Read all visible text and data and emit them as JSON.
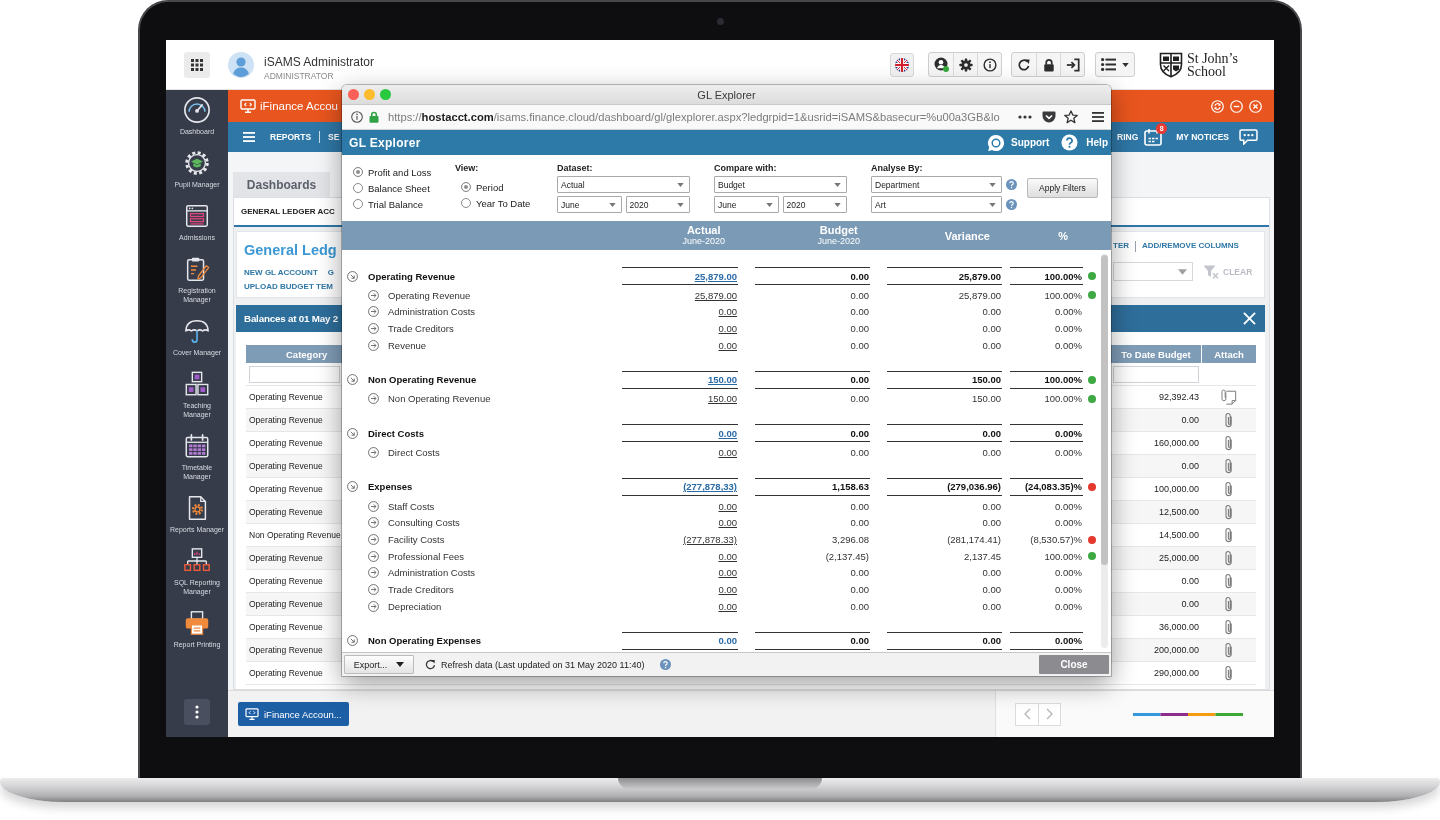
{
  "top_bar": {
    "user_name": "iSAMS Administrator",
    "user_role": "ADMINISTRATOR",
    "school_name": "St John’s School"
  },
  "sidebar": {
    "items": [
      {
        "label": "Dashboard"
      },
      {
        "label": "Pupil Manager"
      },
      {
        "label": "Admissions"
      },
      {
        "label": "Registration Manager"
      },
      {
        "label": "Cover Manager"
      },
      {
        "label": "Teaching Manager"
      },
      {
        "label": "Timetable Manager"
      },
      {
        "label": "Reports Manager"
      },
      {
        "label": "SQL Reporting Manager"
      },
      {
        "label": "Report Printing"
      }
    ]
  },
  "app_bar": {
    "title": "iFinance Accou"
  },
  "nav_bar": {
    "left_links": [
      "REPORTS",
      "SE"
    ],
    "cut_link": "RING",
    "calendar_badge": "8",
    "notices_link": "MY NOTICES"
  },
  "page": {
    "tabs": [
      {
        "label": "Dashboards",
        "selected": false
      }
    ],
    "sub_tab": "GENERAL LEDGER ACC",
    "title": "General Ledg",
    "action_links": [
      [
        "NEW GL ACCOUNT",
        "G"
      ],
      [
        "UPLOAD BUDGET TEM"
      ]
    ],
    "right_links": [
      "TER",
      "ADD/REMOVE COLUMNS"
    ],
    "clear_label": "CLEAR",
    "balances_title": "Balances at 01 May 2",
    "table": {
      "columns": [
        "Category",
        "To Date Budget",
        "Attach"
      ],
      "rows": [
        {
          "category": "Operating Revenue",
          "to_date_budget": "92,392.43",
          "kind": "document"
        },
        {
          "category": "Operating Revenue",
          "to_date_budget": "0.00",
          "kind": "clip"
        },
        {
          "category": "Operating Revenue",
          "to_date_budget": "160,000.00",
          "kind": "clip"
        },
        {
          "category": "Operating Revenue",
          "to_date_budget": "0.00",
          "kind": "clip"
        },
        {
          "category": "Operating Revenue",
          "to_date_budget": "100,000.00",
          "kind": "clip"
        },
        {
          "category": "Operating Revenue",
          "to_date_budget": "12,500.00",
          "kind": "clip"
        },
        {
          "category": "Non Operating Revenue",
          "to_date_budget": "14,500.00",
          "kind": "clip"
        },
        {
          "category": "Operating Revenue",
          "to_date_budget": "25,000.00",
          "kind": "clip"
        },
        {
          "category": "Operating Revenue",
          "to_date_budget": "0.00",
          "kind": "clip"
        },
        {
          "category": "Operating Revenue",
          "to_date_budget": "0.00",
          "kind": "clip"
        },
        {
          "category": "Operating Revenue",
          "to_date_budget": "36,000.00",
          "kind": "clip"
        },
        {
          "category": "Operating Revenue",
          "to_date_budget": "200,000.00",
          "kind": "clip"
        },
        {
          "category": "Operating Revenue",
          "to_date_budget": "290,000.00",
          "kind": "clip"
        }
      ]
    }
  },
  "taskbar": {
    "window_button": "iFinance Accoun..."
  },
  "gl_window": {
    "title": "GL Explorer",
    "url": "https://**hostacct.com**/isams.finance.cloud/dashboard/gl/glexplorer.aspx?ledgrpid=1&usrid=iSAMS&basecur=%u00a3GB&lo",
    "app_title": "GL Explorer",
    "support_label": "Support",
    "help_label": "Help",
    "report_types": [
      {
        "label": "Profit and Loss",
        "selected": true
      },
      {
        "label": "Balance Sheet",
        "selected": false
      },
      {
        "label": "Trial Balance",
        "selected": false
      }
    ],
    "view": {
      "label": "View:",
      "options": [
        {
          "label": "Period",
          "selected": true
        },
        {
          "label": "Year To Date",
          "selected": false
        }
      ]
    },
    "filters": [
      {
        "label": "Dataset:",
        "value": "Actual",
        "sub_values": [
          "June",
          "2020"
        ],
        "help": false
      },
      {
        "label": "Compare with:",
        "value": "Budget",
        "sub_values": [
          "June",
          "2020"
        ],
        "help": false
      },
      {
        "label": "Analyse By:",
        "value": "Department",
        "sub_values": [
          "Art"
        ],
        "help": true
      }
    ],
    "apply_button": "Apply Filters",
    "columns": [
      {
        "title": "Actual",
        "subtitle": "June-2020"
      },
      {
        "title": "Budget",
        "subtitle": "June-2020"
      },
      {
        "title": "Variance"
      },
      {
        "title": "%"
      }
    ],
    "groups": [
      {
        "name": "Operating Revenue",
        "actual": "25,879.00",
        "budget": "0.00",
        "variance": "25,879.00",
        "percent": "100.00%",
        "color": "#3ea843",
        "underlined": true,
        "children": [
          {
            "name": "Operating Revenue",
            "actual": "25,879.00",
            "budget": "0.00",
            "variance": "25,879.00",
            "percent": "100.00%",
            "color": "#3ea843"
          },
          {
            "name": "Administration Costs",
            "actual": "0.00",
            "budget": "0.00",
            "variance": "0.00",
            "percent": "0.00%"
          },
          {
            "name": "Trade Creditors",
            "actual": "0.00",
            "budget": "0.00",
            "variance": "0.00",
            "percent": "0.00%"
          },
          {
            "name": "Revenue",
            "actual": "0.00",
            "budget": "0.00",
            "variance": "0.00",
            "percent": "0.00%"
          }
        ]
      },
      {
        "name": "Non Operating Revenue",
        "actual": "150.00",
        "budget": "0.00",
        "variance": "150.00",
        "percent": "100.00%",
        "color": "#3ea843",
        "underlined": true,
        "children": [
          {
            "name": "Non Operating Revenue",
            "actual": "150.00",
            "budget": "0.00",
            "variance": "150.00",
            "percent": "100.00%",
            "color": "#3ea843"
          }
        ]
      },
      {
        "name": "Direct Costs",
        "actual": "0.00",
        "budget": "0.00",
        "variance": "0.00",
        "percent": "0.00%",
        "underlined": true,
        "children": [
          {
            "name": "Direct Costs",
            "actual": "0.00",
            "budget": "0.00",
            "variance": "0.00",
            "percent": "0.00%"
          }
        ]
      },
      {
        "name": "Expenses",
        "actual": "(277,878,33)",
        "budget": "1,158.63",
        "variance": "(279,036.96)",
        "percent": "(24,083.35)%",
        "color": "#e5392f",
        "underlined": true,
        "children": [
          {
            "name": "Staff Costs",
            "actual": "0.00",
            "budget": "0.00",
            "variance": "0.00",
            "percent": "0.00%"
          },
          {
            "name": "Consulting Costs",
            "actual": "0.00",
            "budget": "0.00",
            "variance": "0.00",
            "percent": "0.00%"
          },
          {
            "name": "Facility Costs",
            "actual": "(277,878.33)",
            "budget": "3,296.08",
            "variance": "(281,174.41)",
            "percent": "(8,530.57)%",
            "color": "#e5392f"
          },
          {
            "name": "Professional Fees",
            "actual": "0.00",
            "budget": "(2,137.45)",
            "variance": "2,137.45",
            "percent": "100.00%",
            "color": "#3ea843"
          },
          {
            "name": "Administration Costs",
            "actual": "0.00",
            "budget": "0.00",
            "variance": "0.00",
            "percent": "0.00%"
          },
          {
            "name": "Trade Creditors",
            "actual": "0.00",
            "budget": "0.00",
            "variance": "0.00",
            "percent": "0.00%"
          },
          {
            "name": "Depreciation",
            "actual": "0.00",
            "budget": "0.00",
            "variance": "0.00",
            "percent": "0.00%"
          }
        ]
      },
      {
        "name": "Non Operating Expenses",
        "actual": "0.00",
        "budget": "0.00",
        "variance": "0.00",
        "percent": "0.00%",
        "underlined": false
      }
    ],
    "export_button": "Export...",
    "refresh_text": "Refresh data (Last updated on 31 May 2020 11:40)",
    "close_button": "Close"
  }
}
